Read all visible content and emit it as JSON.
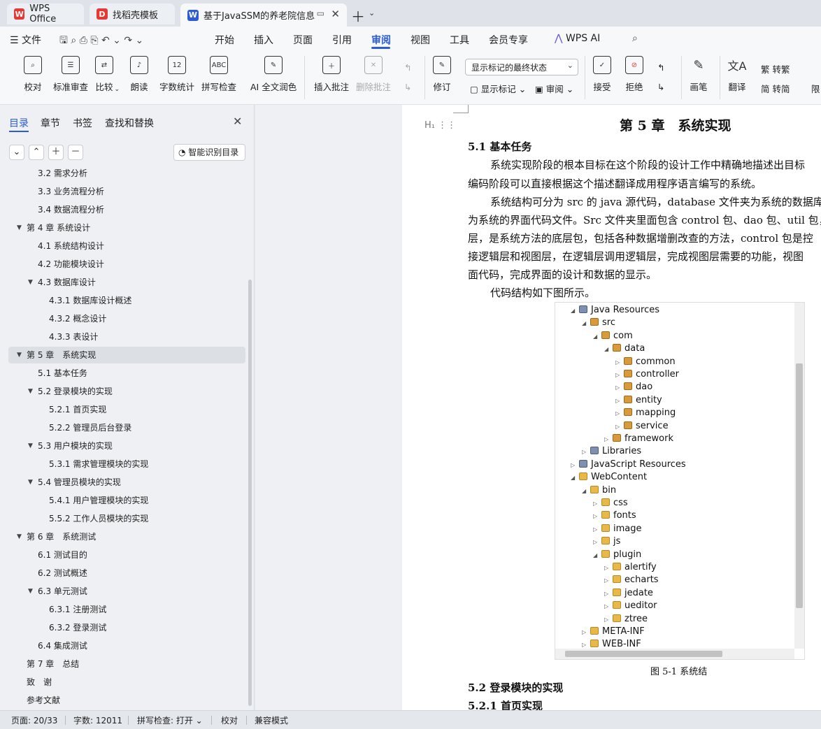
{
  "tabs": [
    {
      "label": "WPS Office",
      "icon": "wps-logo-icon",
      "color": "#e53935"
    },
    {
      "label": "找稻壳模板",
      "icon": "docer-logo-icon",
      "color": "#e53935"
    },
    {
      "label": "基于JavaSSM的养老院信息管",
      "icon": "word-doc-icon",
      "color": "#2b5bd7",
      "active": true
    }
  ],
  "menu": {
    "items": [
      "文件",
      "开始",
      "插入",
      "页面",
      "引用",
      "审阅",
      "视图",
      "工具",
      "会员专享",
      "WPS AI"
    ],
    "active": "审阅"
  },
  "toolbar": {
    "group1": [
      "校对",
      "标准审查",
      "比较",
      "朗读",
      "字数统计",
      "拼写检查",
      "AI 全文润色"
    ],
    "group2": [
      "插入批注",
      "删除批注"
    ],
    "revise": "修订",
    "show_state": "显示标记的最终状态",
    "show_markup": "显示标记",
    "review": "审阅",
    "accept": "接受",
    "reject": "拒绝",
    "pen": "画笔",
    "translate": "翻译",
    "to_trad": "转繁",
    "to_simp": "转简",
    "more": "限"
  },
  "sidebar": {
    "tabs": [
      "目录",
      "章节",
      "书签",
      "查找和替换"
    ],
    "smart_btn": "智能识别目录",
    "toc": [
      {
        "label": "3.2 需求分析",
        "level": 2
      },
      {
        "label": "3.3 业务流程分析",
        "level": 2
      },
      {
        "label": "3.4 数据流程分析",
        "level": 2
      },
      {
        "label": "第 4 章 系统设计",
        "level": 1,
        "exp": true
      },
      {
        "label": "4.1 系统结构设计",
        "level": 2
      },
      {
        "label": "4.2 功能模块设计",
        "level": 2
      },
      {
        "label": "4.3 数据库设计",
        "level": 2,
        "exp": true
      },
      {
        "label": "4.3.1 数据库设计概述",
        "level": 3
      },
      {
        "label": "4.3.2 概念设计",
        "level": 3
      },
      {
        "label": "4.3.3 表设计",
        "level": 3
      },
      {
        "label": "第 5 章　系统实现",
        "level": 1,
        "exp": true,
        "sel": true
      },
      {
        "label": "5.1 基本任务",
        "level": 2
      },
      {
        "label": "5.2 登录模块的实现",
        "level": 2,
        "exp": true
      },
      {
        "label": "5.2.1 首页实现",
        "level": 3
      },
      {
        "label": "5.2.2 管理员后台登录",
        "level": 3
      },
      {
        "label": "5.3 用户模块的实现",
        "level": 2,
        "exp": true
      },
      {
        "label": "5.3.1 需求管理模块的实现",
        "level": 3
      },
      {
        "label": "5.4 管理员模块的实现",
        "level": 2,
        "exp": true
      },
      {
        "label": "5.4.1 用户管理模块的实现",
        "level": 3
      },
      {
        "label": "5.5.2 工作人员模块的实现",
        "level": 3
      },
      {
        "label": "第 6 章　系统测试",
        "level": 1,
        "exp": true
      },
      {
        "label": "6.1 测试目的",
        "level": 2
      },
      {
        "label": "6.2 测试概述",
        "level": 2
      },
      {
        "label": "6.3 单元测试",
        "level": 2,
        "exp": true
      },
      {
        "label": "6.3.1 注册测试",
        "level": 3
      },
      {
        "label": "6.3.2 登录测试",
        "level": 3
      },
      {
        "label": "6.4 集成测试",
        "level": 2
      },
      {
        "label": "第 7 章　总结",
        "level": 1
      },
      {
        "label": "致　谢",
        "level": 1
      },
      {
        "label": "参考文献",
        "level": 1
      }
    ]
  },
  "doc": {
    "chapter_title": "第 5 章　系统实现",
    "h_51": "5.1 基本任务",
    "p1_l1": "系统实现阶段的根本目标在这个阶段的设计工作中精确地描述出目标",
    "p1_l2": "编码阶段可以直接根据这个描述翻译成用程序语言编写的系统。",
    "p2_l1": "系统结构可分为 src 的 java 源代码，database 文件夹为系统的数据库文",
    "p2_l2": "为系统的界面代码文件。Src 文件夹里面包含 control 包、dao 包、util 包，",
    "p2_l3": "层，是系统方法的底层包，包括各种数据增删改查的方法，control 包是控",
    "p2_l4": "接逻辑层和视图层，在逻辑层调用逻辑层，完成视图层需要的功能，视图",
    "p2_l5": "面代码，完成界面的设计和数据的显示。",
    "p3": "代码结构如下图所示。",
    "caption": "图 5-1 系统结",
    "h_52": "5.2 登录模块的实现",
    "h_521": "5.2.1 首页实现",
    "tree": [
      {
        "label": "Java Resources",
        "d": 0,
        "t": "jr",
        "exp": true
      },
      {
        "label": "src",
        "d": 1,
        "t": "pkg",
        "exp": true
      },
      {
        "label": "com",
        "d": 2,
        "t": "pkg",
        "exp": true
      },
      {
        "label": "data",
        "d": 3,
        "t": "pkg",
        "exp": true
      },
      {
        "label": "common",
        "d": 4,
        "t": "pkg"
      },
      {
        "label": "controller",
        "d": 4,
        "t": "pkg"
      },
      {
        "label": "dao",
        "d": 4,
        "t": "pkg"
      },
      {
        "label": "entity",
        "d": 4,
        "t": "pkg"
      },
      {
        "label": "mapping",
        "d": 4,
        "t": "pkg"
      },
      {
        "label": "service",
        "d": 4,
        "t": "pkg"
      },
      {
        "label": "framework",
        "d": 3,
        "t": "pkg"
      },
      {
        "label": "Libraries",
        "d": 1,
        "t": "jr"
      },
      {
        "label": "JavaScript Resources",
        "d": 0,
        "t": "jr"
      },
      {
        "label": "WebContent",
        "d": 0,
        "t": "fold",
        "exp": true
      },
      {
        "label": "bin",
        "d": 1,
        "t": "fold",
        "exp": true
      },
      {
        "label": "css",
        "d": 2,
        "t": "fold"
      },
      {
        "label": "fonts",
        "d": 2,
        "t": "fold"
      },
      {
        "label": "image",
        "d": 2,
        "t": "fold"
      },
      {
        "label": "js",
        "d": 2,
        "t": "fold"
      },
      {
        "label": "plugin",
        "d": 2,
        "t": "fold",
        "exp": true
      },
      {
        "label": "alertify",
        "d": 3,
        "t": "fold"
      },
      {
        "label": "echarts",
        "d": 3,
        "t": "fold"
      },
      {
        "label": "jedate",
        "d": 3,
        "t": "fold"
      },
      {
        "label": "ueditor",
        "d": 3,
        "t": "fold"
      },
      {
        "label": "ztree",
        "d": 3,
        "t": "fold"
      },
      {
        "label": "META-INF",
        "d": 1,
        "t": "fold"
      },
      {
        "label": "WEB-INF",
        "d": 1,
        "t": "fold"
      }
    ]
  },
  "status": {
    "page": "页面: 20/33",
    "words": "字数: 12011",
    "spell": "拼写检查: 打开",
    "proof": "校对",
    "compat": "兼容模式"
  }
}
